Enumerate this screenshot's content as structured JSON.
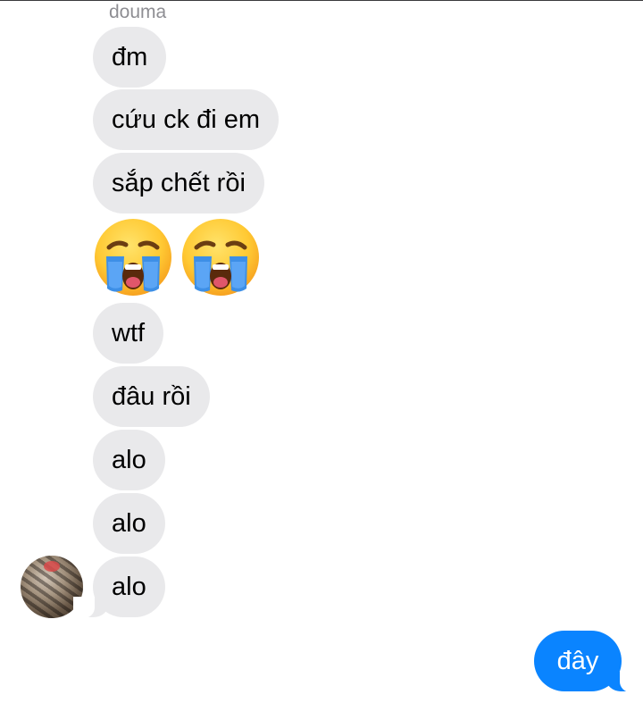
{
  "conversation": {
    "sender_name": "douma",
    "incoming_messages": [
      "đm",
      "cứu ck đi em",
      "sắp chết rồi",
      "wtf",
      "đâu rồi",
      "alo",
      "alo",
      "alo"
    ],
    "emoji_message": {
      "icons": [
        "loudly-crying-face-icon",
        "loudly-crying-face-icon"
      ]
    },
    "outgoing_messages": [
      "đây"
    ]
  },
  "colors": {
    "incoming_bubble": "#e9e9eb",
    "outgoing_bubble": "#0a84ff",
    "sender_name": "#8e8e93"
  }
}
